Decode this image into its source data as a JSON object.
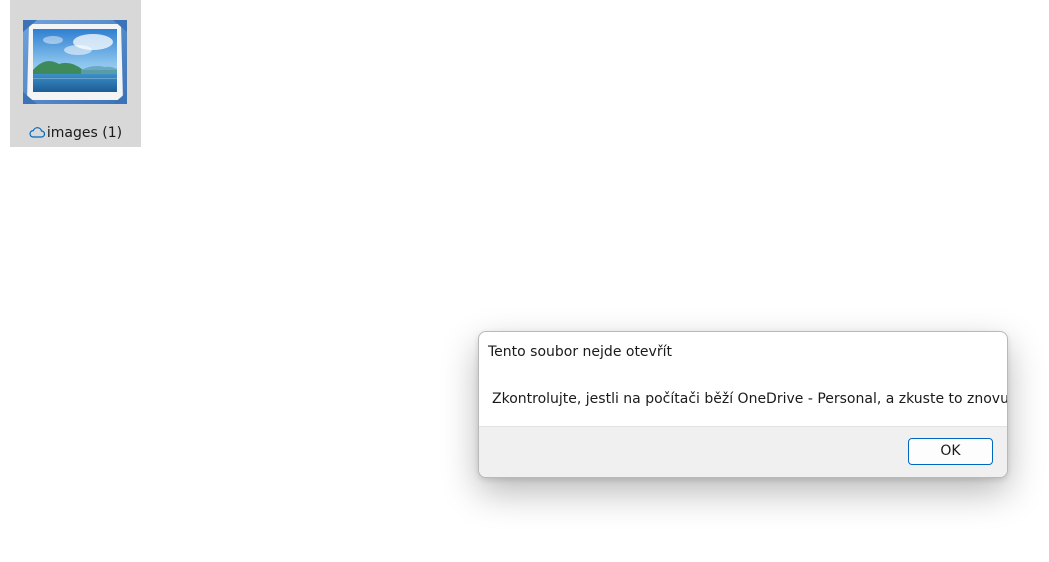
{
  "desktop": {
    "file": {
      "name": "images (1)",
      "icon": "image-file-icon",
      "status_icon": "cloud-icon"
    }
  },
  "dialog": {
    "title": "Tento soubor nejde otevřít",
    "message": "Zkontrolujte, jestli na počítači běží OneDrive - Personal, a zkuste to znovu.",
    "ok_label": "OK"
  },
  "colors": {
    "accent": "#0067c0",
    "tile_selected": "#d8d8d8",
    "footer": "#f0f0f0"
  }
}
